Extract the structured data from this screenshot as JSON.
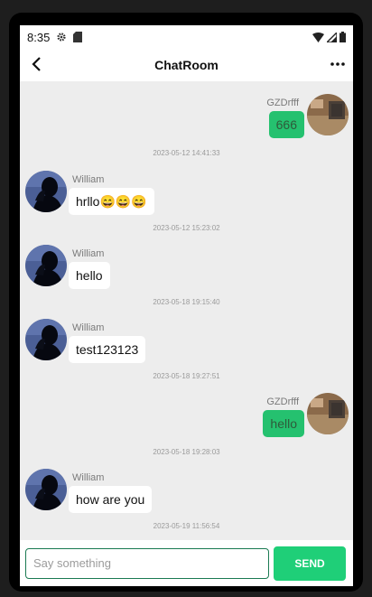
{
  "status_bar": {
    "time": "8:35"
  },
  "app_bar": {
    "title": "ChatRoom"
  },
  "messages": [
    {
      "sender": "GZDrfff",
      "text": "666",
      "timestamp": "2023-05-12 14:41:33"
    },
    {
      "sender": "William",
      "text": "hrllo😄😄😄",
      "timestamp": "2023-05-12 15:23:02"
    },
    {
      "sender": "William",
      "text": "hello",
      "timestamp": "2023-05-18 19:15:40"
    },
    {
      "sender": "William",
      "text": "test123123",
      "timestamp": "2023-05-18 19:27:51"
    },
    {
      "sender": "GZDrfff",
      "text": "hello",
      "timestamp": "2023-05-18 19:28:03"
    },
    {
      "sender": "William",
      "text": "how are you",
      "timestamp": "2023-05-19 11:56:54"
    }
  ],
  "input": {
    "placeholder": "Say something",
    "value": ""
  },
  "send_button": {
    "label": "SEND"
  },
  "colors": {
    "accent": "#1fcf78",
    "bubble_out": "#25c16f",
    "chat_bg": "#ededed"
  }
}
